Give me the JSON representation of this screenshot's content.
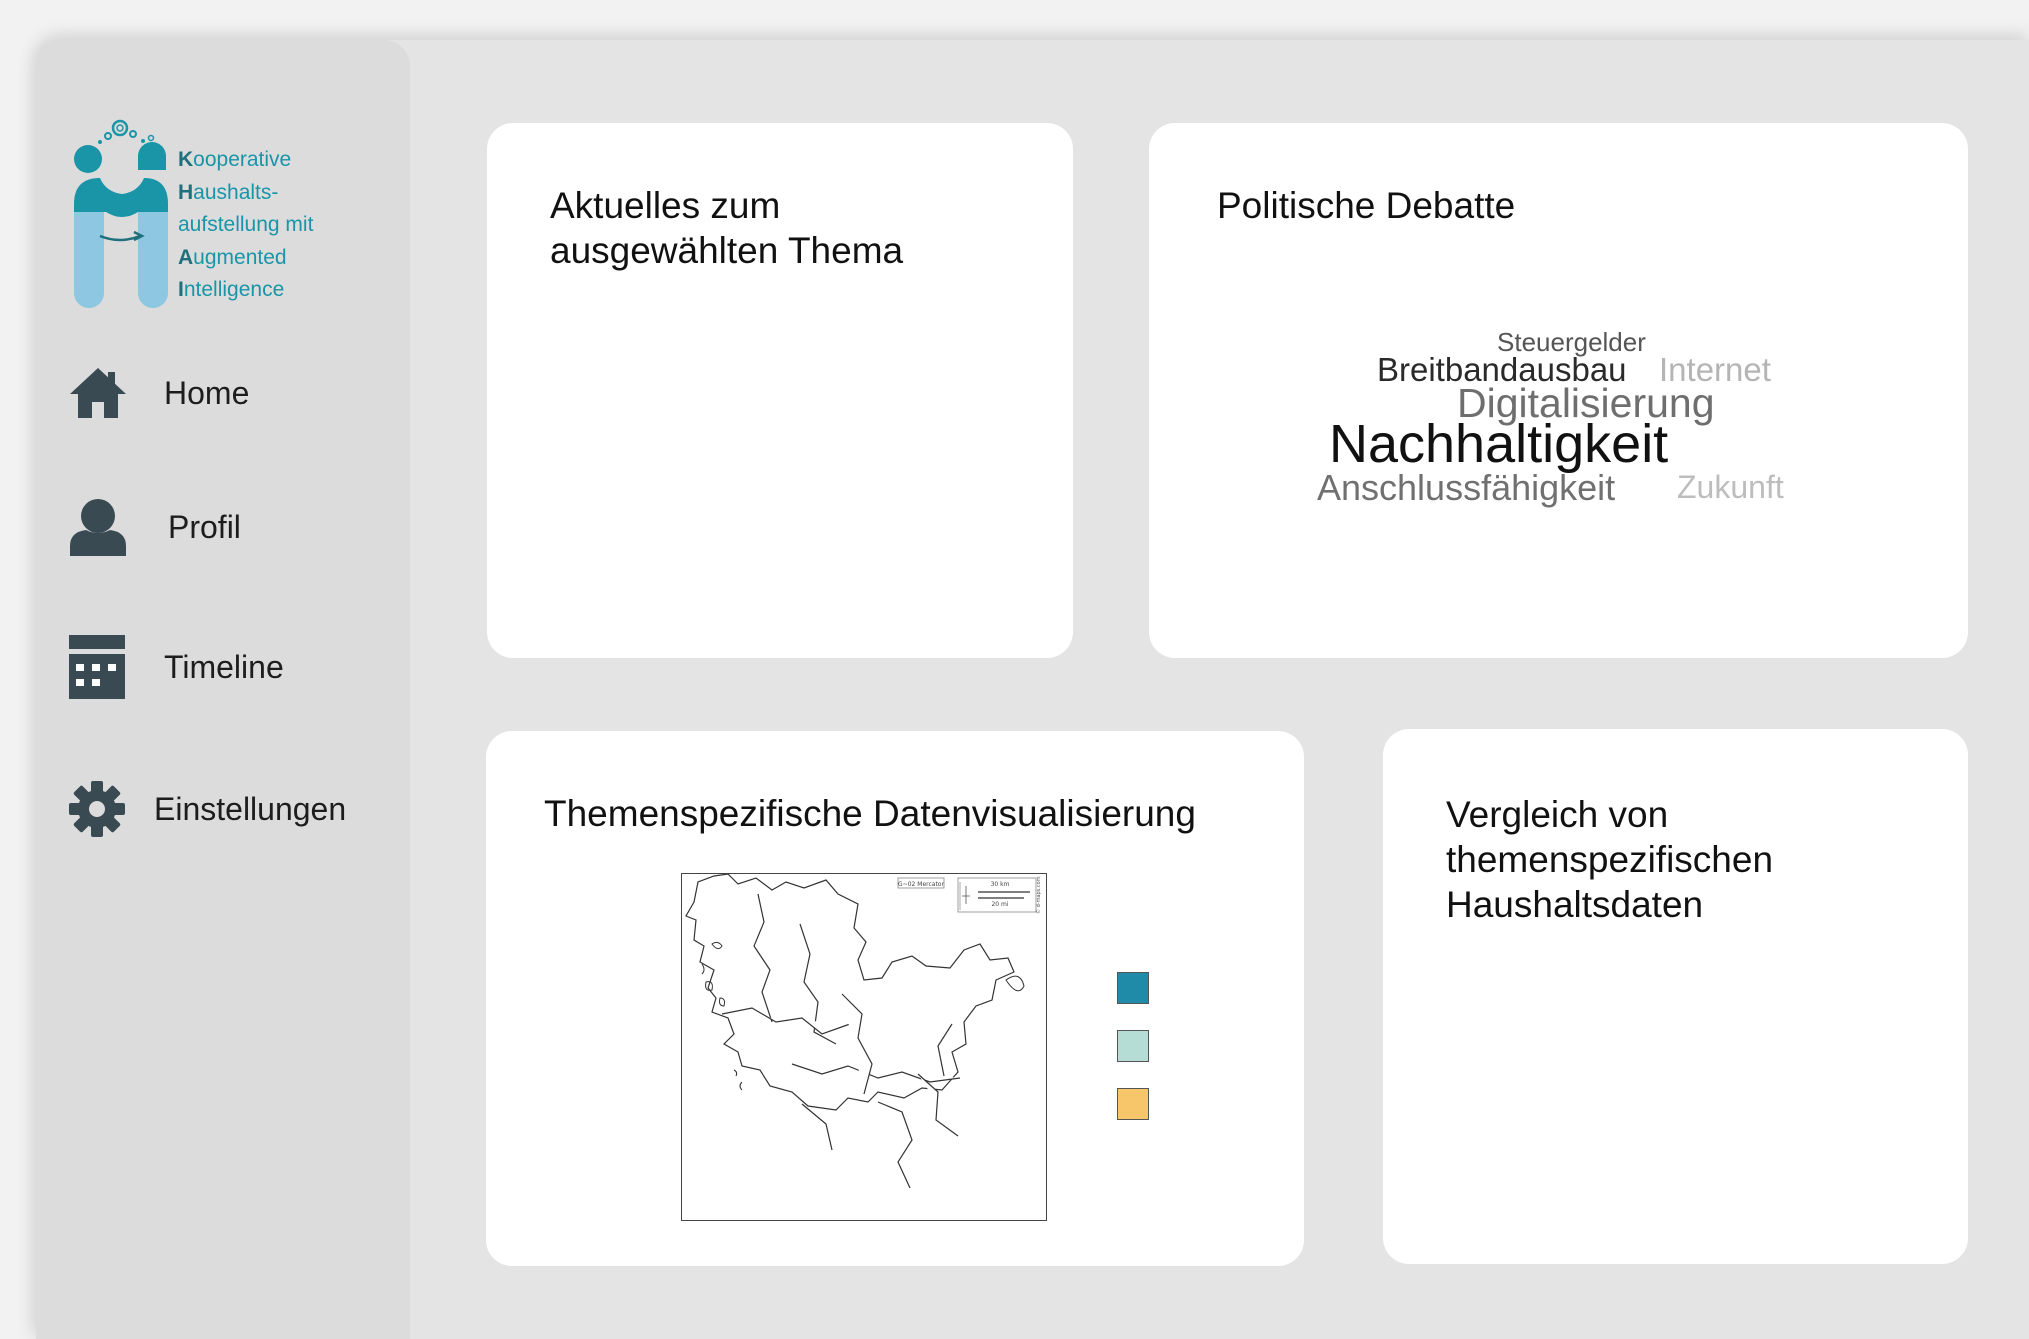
{
  "logo": {
    "lines": [
      {
        "initial": "K",
        "rest": "ooperative"
      },
      {
        "initial": "H",
        "rest": "aushalts-"
      },
      {
        "initial": "",
        "rest": "aufstellung mit"
      },
      {
        "initial": "A",
        "rest": "ugmented"
      },
      {
        "initial": "I",
        "rest": "ntelligence"
      }
    ]
  },
  "nav": {
    "items": [
      {
        "label": "Home",
        "icon": "home-icon"
      },
      {
        "label": "Profil",
        "icon": "user-icon"
      },
      {
        "label": "Timeline",
        "icon": "calendar-icon"
      },
      {
        "label": "Einstellungen",
        "icon": "gear-icon"
      }
    ]
  },
  "cards": {
    "news": {
      "title": "Aktuelles zum\nausgewählten Thema"
    },
    "debate": {
      "title": "Politische Debatte",
      "words": [
        "Steuergelder",
        "Breitbandausbau",
        "Internet",
        "Digitalisierung",
        "Nachhaltigkeit",
        "Anschlussfähigkeit",
        "Zukunft"
      ]
    },
    "dataviz": {
      "title": "Themenspezifische Datenvisualisierung",
      "legend_colors": [
        "#1f8ba8",
        "#b6ddd5",
        "#f7c56a"
      ],
      "map_badge": "G~02 Mercator",
      "scale_km": "30 km",
      "scale_mi": "20 mi",
      "credit": "© d-maps.com"
    },
    "compare": {
      "title": "Vergleich von\nthemenspezifischen\nHaushaltsdaten"
    }
  },
  "colors": {
    "brand_teal": "#1a95a8",
    "brand_light": "#8ec7e2",
    "icon_dark": "#3a4a52"
  }
}
